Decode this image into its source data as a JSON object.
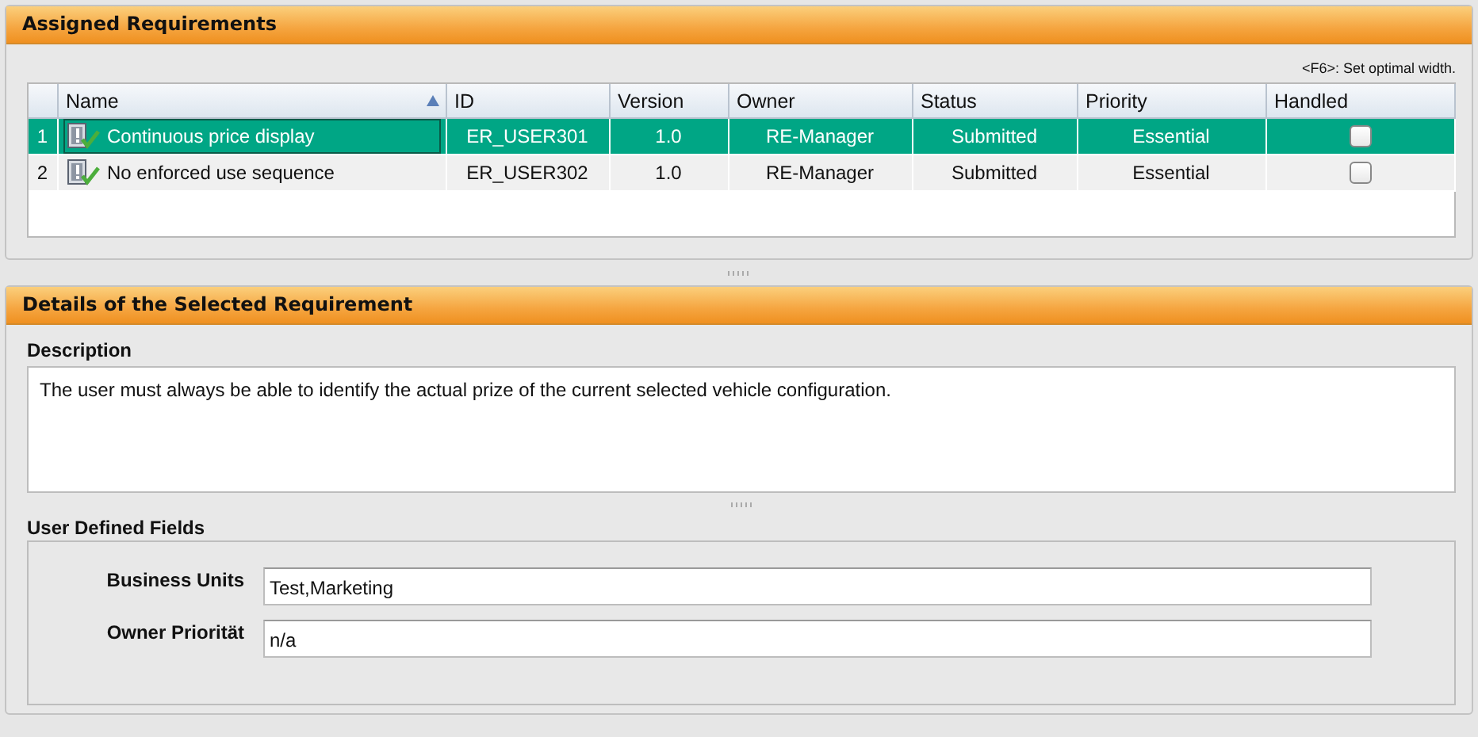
{
  "assigned": {
    "title": "Assigned Requirements",
    "hint": "<F6>: Set optimal width.",
    "columns": [
      {
        "label": "Name",
        "sorted": true
      },
      {
        "label": "ID",
        "sorted": false
      },
      {
        "label": "Version",
        "sorted": false
      },
      {
        "label": "Owner",
        "sorted": false
      },
      {
        "label": "Status",
        "sorted": false
      },
      {
        "label": "Priority",
        "sorted": false
      },
      {
        "label": "Handled",
        "sorted": false
      }
    ],
    "rows": [
      {
        "number": "1",
        "name": "Continuous price display",
        "id": "ER_USER301",
        "version": "1.0",
        "owner": "RE-Manager",
        "status": "Submitted",
        "priority": "Essential",
        "handled": false,
        "selected": true
      },
      {
        "number": "2",
        "name": "No enforced use sequence",
        "id": "ER_USER302",
        "version": "1.0",
        "owner": "RE-Manager",
        "status": "Submitted",
        "priority": "Essential",
        "handled": false,
        "selected": false
      }
    ]
  },
  "details": {
    "title": "Details of the Selected Requirement",
    "description_label": "Description",
    "description": "The user must always be able to identify the actual prize of the current selected vehicle configuration.",
    "user_fields_label": "User Defined Fields",
    "fields": [
      {
        "label": "Business Units",
        "value": "Test,Marketing"
      },
      {
        "label": "Owner Priorität",
        "value": "n/a"
      }
    ]
  }
}
